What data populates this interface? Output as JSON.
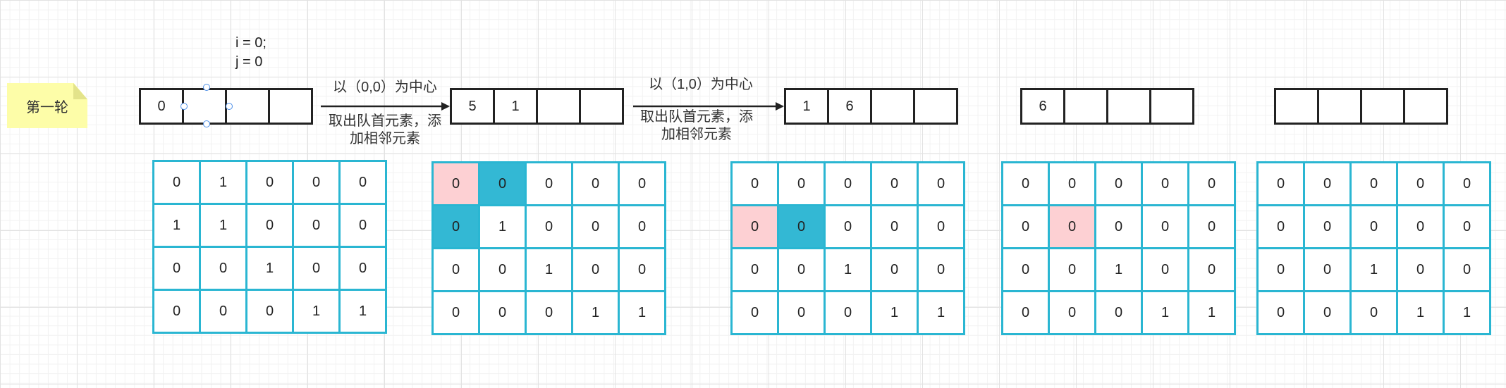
{
  "note": "第一轮",
  "index_label": {
    "line1": "i = 0;",
    "line2": "j = 0"
  },
  "arrow1": {
    "top": "以（0,0）为中心",
    "bottom1": "取出队首元素，添",
    "bottom2": "加相邻元素"
  },
  "arrow2": {
    "top": "以（1,0）为中心",
    "bottom1": "取出队首元素，添",
    "bottom2": "加相邻元素"
  },
  "queues": [
    [
      "0",
      "",
      "",
      ""
    ],
    [
      "5",
      "1",
      "",
      ""
    ],
    [
      "1",
      "6",
      "",
      ""
    ],
    [
      "6",
      "",
      "",
      ""
    ],
    [
      "",
      "",
      "",
      ""
    ]
  ],
  "grids": [
    {
      "cells": [
        [
          "0",
          "1",
          "0",
          "0",
          "0"
        ],
        [
          "1",
          "1",
          "0",
          "0",
          "0"
        ],
        [
          "0",
          "0",
          "1",
          "0",
          "0"
        ],
        [
          "0",
          "0",
          "0",
          "1",
          "1"
        ]
      ],
      "highlights": []
    },
    {
      "cells": [
        [
          "0",
          "0",
          "0",
          "0",
          "0"
        ],
        [
          "0",
          "1",
          "0",
          "0",
          "0"
        ],
        [
          "0",
          "0",
          "1",
          "0",
          "0"
        ],
        [
          "0",
          "0",
          "0",
          "1",
          "1"
        ]
      ],
      "highlights": [
        [
          0,
          0,
          "pink"
        ],
        [
          0,
          1,
          "teal"
        ],
        [
          1,
          0,
          "teal"
        ]
      ]
    },
    {
      "cells": [
        [
          "0",
          "0",
          "0",
          "0",
          "0"
        ],
        [
          "0",
          "0",
          "0",
          "0",
          "0"
        ],
        [
          "0",
          "0",
          "1",
          "0",
          "0"
        ],
        [
          "0",
          "0",
          "0",
          "1",
          "1"
        ]
      ],
      "highlights": [
        [
          1,
          0,
          "pink"
        ],
        [
          1,
          1,
          "teal"
        ]
      ]
    },
    {
      "cells": [
        [
          "0",
          "0",
          "0",
          "0",
          "0"
        ],
        [
          "0",
          "0",
          "0",
          "0",
          "0"
        ],
        [
          "0",
          "0",
          "1",
          "0",
          "0"
        ],
        [
          "0",
          "0",
          "0",
          "1",
          "1"
        ]
      ],
      "highlights": [
        [
          1,
          1,
          "pink"
        ]
      ]
    },
    {
      "cells": [
        [
          "0",
          "0",
          "0",
          "0",
          "0"
        ],
        [
          "0",
          "0",
          "0",
          "0",
          "0"
        ],
        [
          "0",
          "0",
          "1",
          "0",
          "0"
        ],
        [
          "0",
          "0",
          "0",
          "1",
          "1"
        ]
      ],
      "highlights": []
    }
  ],
  "colors": {
    "grid_border": "#2ab6d2",
    "pink": "#fdd0d3",
    "teal": "#33b8d4",
    "note_bg": "#fdfda8"
  }
}
